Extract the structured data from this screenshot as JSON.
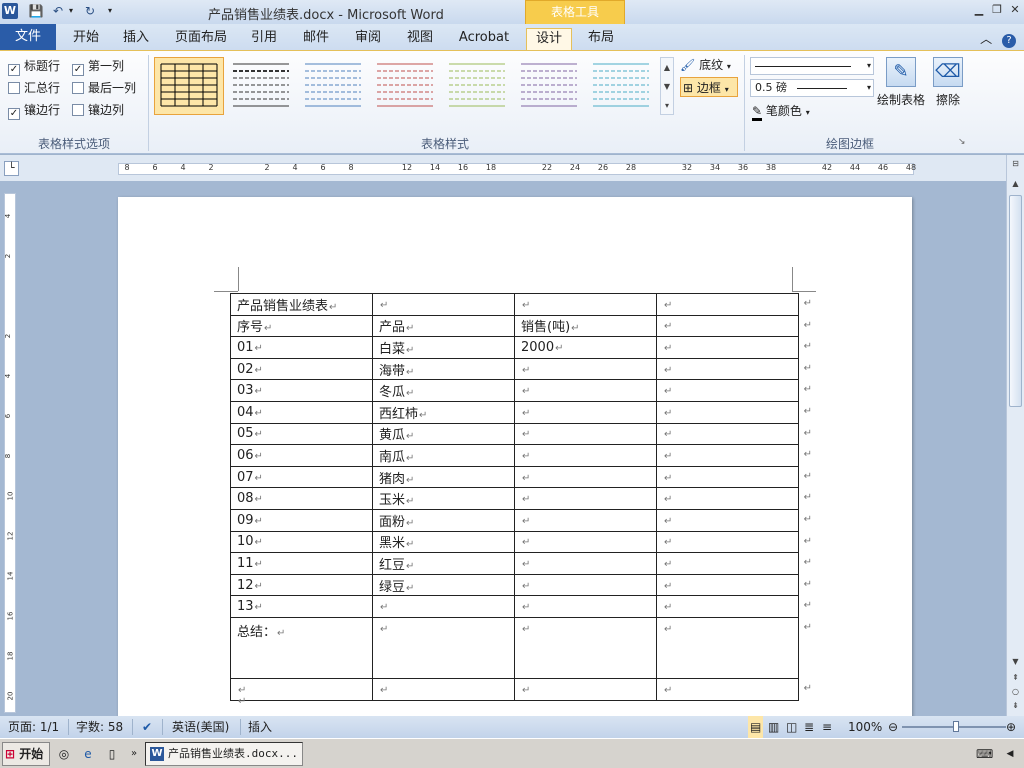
{
  "titlebar": {
    "title": "产品销售业绩表.docx - Microsoft Word",
    "contextual_tab": "表格工具"
  },
  "tabs": [
    "文件",
    "开始",
    "插入",
    "页面布局",
    "引用",
    "邮件",
    "审阅",
    "视图",
    "Acrobat",
    "设计",
    "布局"
  ],
  "ribbon": {
    "options_group": {
      "label": "表格样式选项",
      "checkboxes": [
        {
          "label": "标题行",
          "checked": true
        },
        {
          "label": "第一列",
          "checked": true
        },
        {
          "label": "汇总行",
          "checked": false
        },
        {
          "label": "最后一列",
          "checked": false
        },
        {
          "label": "镶边行",
          "checked": true
        },
        {
          "label": "镶边列",
          "checked": false
        }
      ]
    },
    "styles_group": {
      "label": "表格样式",
      "shading": "底纹",
      "borders": "边框",
      "swatch_colors": [
        "#000000",
        "#333333",
        "#4f81bd",
        "#c0504d",
        "#9bbb59",
        "#8064a2",
        "#4bacc6"
      ]
    },
    "draw_group": {
      "label": "绘图边框",
      "line_weight": "0.5 磅",
      "pen_color": "笔颜色",
      "draw_table": "绘制表格",
      "eraser": "擦除"
    }
  },
  "ruler_labels": [
    "8",
    "6",
    "4",
    "2",
    "",
    "2",
    "4",
    "6",
    "8",
    "",
    "12",
    "14",
    "16",
    "18",
    "",
    "22",
    "24",
    "26",
    "28",
    "",
    "32",
    "34",
    "36",
    "38",
    "",
    "42",
    "44",
    "46",
    "48"
  ],
  "vruler_labels": [
    "4",
    "2",
    "",
    "2",
    "4",
    "6",
    "8",
    "10",
    "12",
    "14",
    "16",
    "18",
    "20"
  ],
  "table": {
    "rows": [
      [
        "产品销售业绩表",
        "",
        "",
        ""
      ],
      [
        "序号",
        "产品",
        "销售(吨)",
        ""
      ],
      [
        "01",
        "白菜",
        "2000",
        ""
      ],
      [
        "02",
        "海带",
        "",
        ""
      ],
      [
        "03",
        "冬瓜",
        "",
        ""
      ],
      [
        "04",
        "西红柿",
        "",
        ""
      ],
      [
        "05",
        "黄瓜",
        "",
        ""
      ],
      [
        "06",
        "南瓜",
        "",
        ""
      ],
      [
        "07",
        "猪肉",
        "",
        ""
      ],
      [
        "08",
        "玉米",
        "",
        ""
      ],
      [
        "09",
        "面粉",
        "",
        ""
      ],
      [
        "10",
        "黑米",
        "",
        ""
      ],
      [
        "11",
        "红豆",
        "",
        ""
      ],
      [
        "12",
        "绿豆",
        "",
        ""
      ],
      [
        "13",
        "",
        "",
        ""
      ],
      [
        "总结：",
        "",
        "",
        ""
      ],
      [
        "",
        "",
        "",
        ""
      ]
    ],
    "mark": "↵"
  },
  "statusbar": {
    "page": "页面: 1/1",
    "words": "字数: 58",
    "language": "英语(美国)",
    "mode": "插入",
    "zoom": "100%",
    "zoom_level": 1.0
  },
  "taskbar": {
    "start": "开始",
    "task_label": "产品销售业绩表.docx..."
  }
}
